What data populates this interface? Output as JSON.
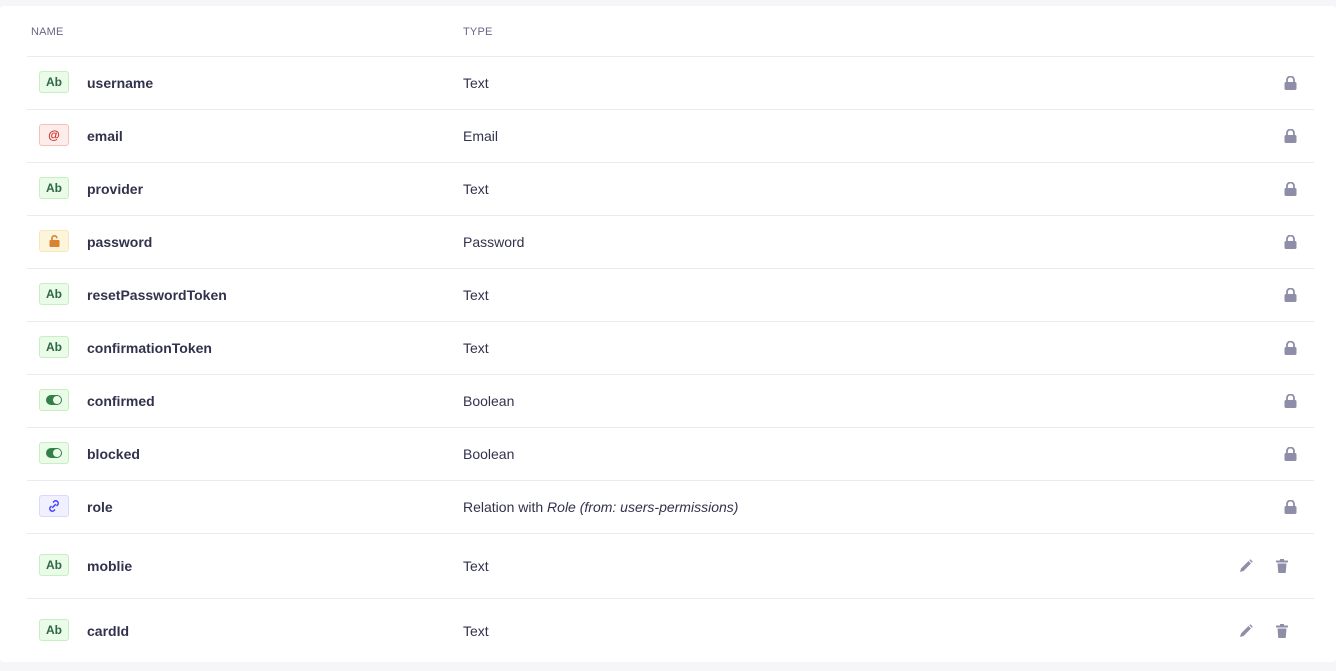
{
  "table": {
    "headers": {
      "name": "NAME",
      "type": "TYPE"
    },
    "rows": [
      {
        "badge": "Ab",
        "kind": "text",
        "name": "username",
        "type": "Text",
        "locked": true
      },
      {
        "badge": "@",
        "kind": "email",
        "name": "email",
        "type": "Email",
        "locked": true
      },
      {
        "badge": "Ab",
        "kind": "text",
        "name": "provider",
        "type": "Text",
        "locked": true
      },
      {
        "badge": "",
        "kind": "password",
        "name": "password",
        "type": "Password",
        "locked": true
      },
      {
        "badge": "Ab",
        "kind": "text",
        "name": "resetPasswordToken",
        "type": "Text",
        "locked": true
      },
      {
        "badge": "Ab",
        "kind": "text",
        "name": "confirmationToken",
        "type": "Text",
        "locked": true
      },
      {
        "badge": "",
        "kind": "boolean",
        "name": "confirmed",
        "type": "Boolean",
        "locked": true
      },
      {
        "badge": "",
        "kind": "boolean",
        "name": "blocked",
        "type": "Boolean",
        "locked": true
      },
      {
        "badge": "",
        "kind": "relation",
        "name": "role",
        "type_prefix": "Relation with ",
        "type_target": "Role",
        "type_suffix": " (from: users-permissions)",
        "locked": true
      },
      {
        "badge": "Ab",
        "kind": "text",
        "name": "moblie",
        "type": "Text",
        "locked": false
      },
      {
        "badge": "Ab",
        "kind": "text",
        "name": "cardId",
        "type": "Text",
        "locked": false
      }
    ]
  },
  "icons": {
    "lock": "lock-icon",
    "edit": "pencil-icon",
    "delete": "trash-icon"
  },
  "colors": {
    "text_badge": "#2f6846",
    "email_badge": "#d02b20",
    "password_badge": "#d9822f",
    "relation_badge": "#4945ff",
    "icon_grey": "#8e8ea9"
  }
}
